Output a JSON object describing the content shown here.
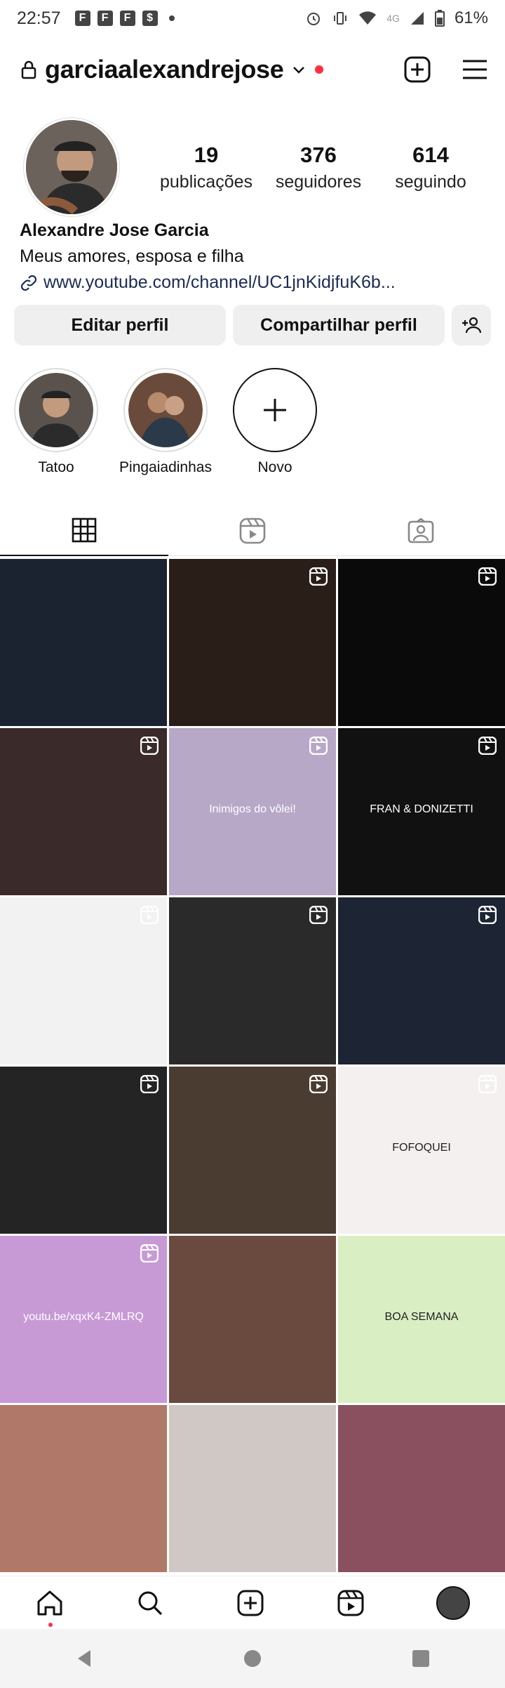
{
  "status_bar": {
    "time": "22:57",
    "notif_icons": [
      "F",
      "F",
      "F",
      "$"
    ],
    "network": "4G",
    "battery": "61%"
  },
  "header": {
    "username": "garciaalexandrejose"
  },
  "profile": {
    "stats": [
      {
        "value": "19",
        "label": "publicações"
      },
      {
        "value": "376",
        "label": "seguidores"
      },
      {
        "value": "614",
        "label": "seguindo"
      }
    ],
    "full_name": "Alexandre Jose Garcia",
    "bio": "Meus amores, esposa e filha",
    "link": "www.youtube.com/channel/UC1jnKidjfuK6b..."
  },
  "buttons": {
    "edit": "Editar perfil",
    "share": "Compartilhar perfil"
  },
  "highlights": [
    {
      "label": "Tatoo"
    },
    {
      "label": "Pingaiadinhas"
    },
    {
      "label": "Novo"
    }
  ],
  "grid": {
    "posts": [
      {
        "bg": "#1b2230",
        "reel": false,
        "text": ""
      },
      {
        "bg": "#2a1e18",
        "reel": true,
        "text": ""
      },
      {
        "bg": "#0a0a0a",
        "reel": true,
        "text": ""
      },
      {
        "bg": "#3a2a2a",
        "reel": true,
        "text": ""
      },
      {
        "bg": "#b7a8c8",
        "reel": true,
        "text": "Inimigos do vôlei!"
      },
      {
        "bg": "#111111",
        "reel": true,
        "text": "FRAN & DONIZETTI"
      },
      {
        "bg": "#f2f2f2",
        "reel": true,
        "text": ""
      },
      {
        "bg": "#2a2a2a",
        "reel": true,
        "text": ""
      },
      {
        "bg": "#1d2433",
        "reel": true,
        "text": ""
      },
      {
        "bg": "#242424",
        "reel": true,
        "text": ""
      },
      {
        "bg": "#4a3c30",
        "reel": true,
        "text": ""
      },
      {
        "bg": "#f4f0f0",
        "reel": true,
        "text": "FOFOQUEI"
      },
      {
        "bg": "#c79ad6",
        "reel": true,
        "text": "youtu.be/xqxK4-ZMLRQ"
      },
      {
        "bg": "#6a4a3e",
        "reel": false,
        "text": ""
      },
      {
        "bg": "#d9efc3",
        "reel": false,
        "text": "BOA SEMANA"
      },
      {
        "bg": "#b07868",
        "reel": false,
        "text": ""
      },
      {
        "bg": "#cfc8c4",
        "reel": false,
        "text": ""
      },
      {
        "bg": "#8a5060",
        "reel": false,
        "text": ""
      }
    ]
  },
  "colors": {
    "accent_red": "#ff3040",
    "button_bg": "#efefef"
  }
}
